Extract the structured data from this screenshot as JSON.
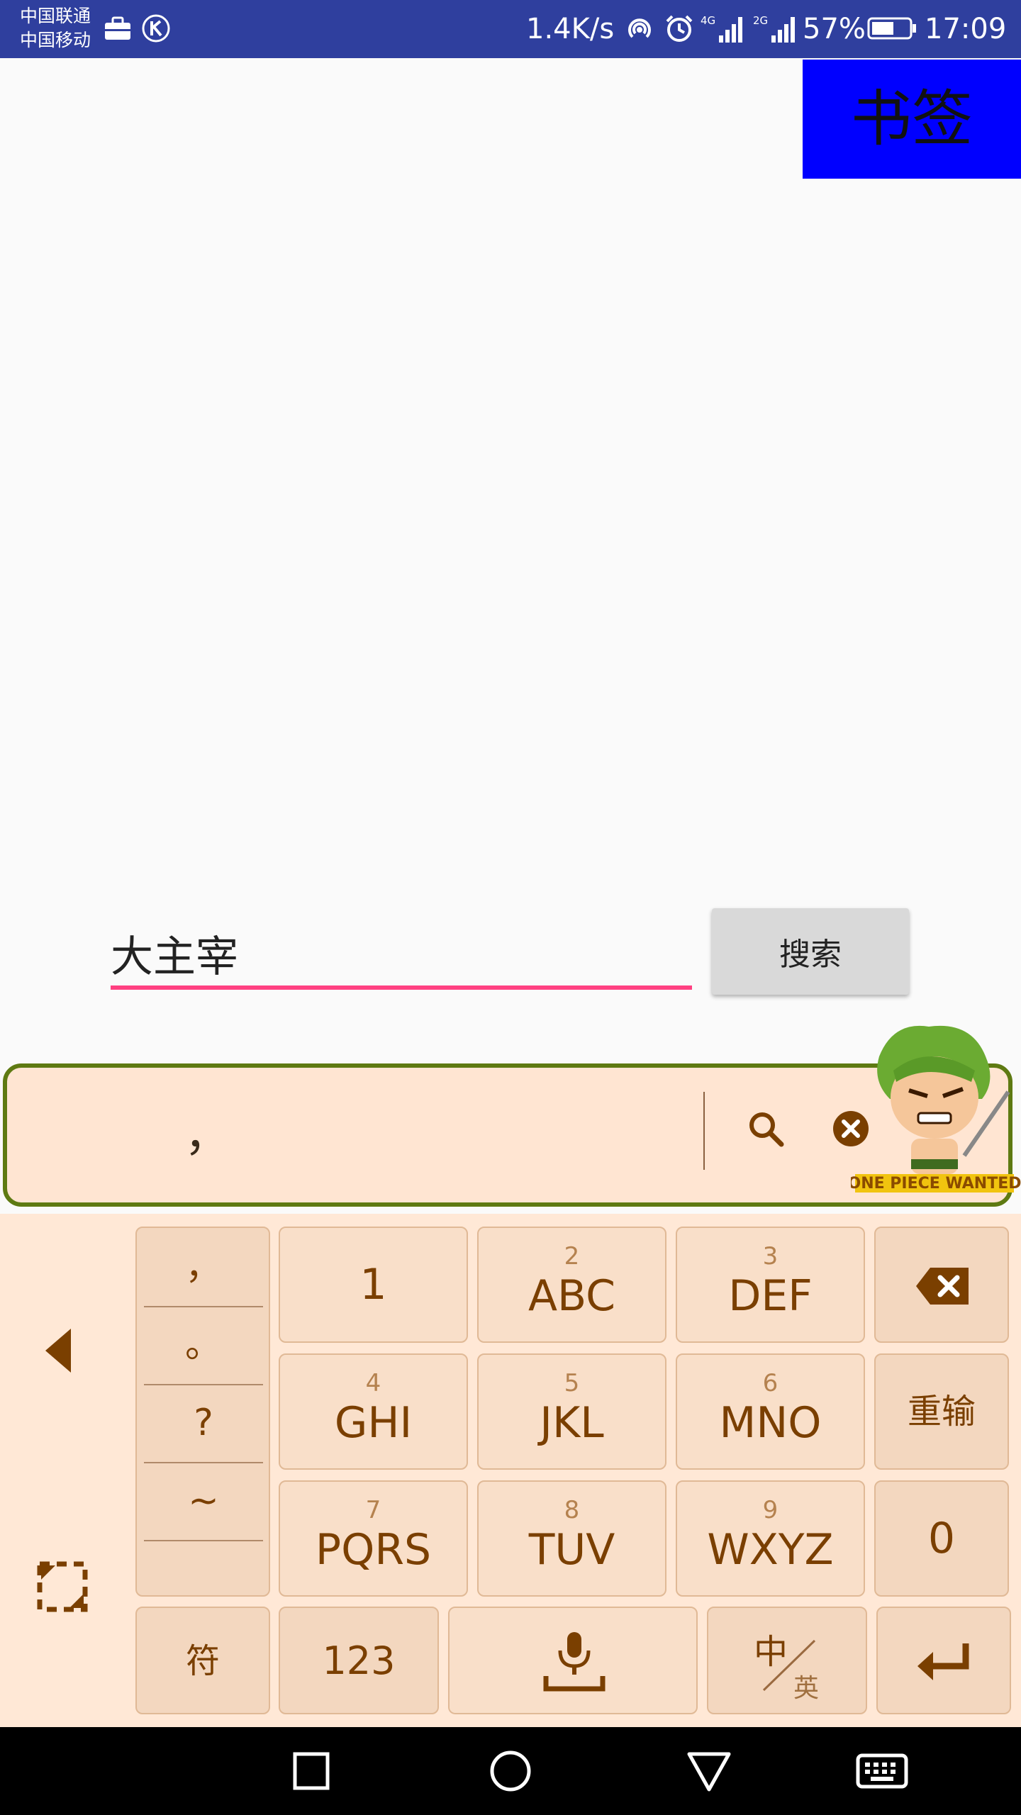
{
  "status_bar": {
    "carrier_1": "中国联通",
    "carrier_2": "中国移动",
    "network_speed": "1.4K/s",
    "signal_4g": "4G",
    "signal_2g": "2G",
    "battery_percent": "57%",
    "time": "17:09",
    "icons": [
      "briefcase-icon",
      "k-app-icon",
      "hotspot-icon",
      "alarm-icon",
      "signal-4g-icon",
      "signal-2g-icon",
      "battery-icon"
    ]
  },
  "app": {
    "bookmark_label": "书签",
    "search_input_value": "大主宰",
    "search_button_label": "搜索",
    "colors": {
      "bookmark_bg": "#0000ff",
      "underline": "#ff4081",
      "statusbar": "#2f3f9e"
    }
  },
  "candidate_bar": {
    "candidate_text": "，",
    "mascot_caption": "ONE PIECE WANTED"
  },
  "keyboard": {
    "punctuation": [
      "，",
      "。",
      "?",
      "~"
    ],
    "keys": {
      "k1": {
        "num": "",
        "label": "1"
      },
      "k2": {
        "num": "2",
        "label": "ABC"
      },
      "k3": {
        "num": "3",
        "label": "DEF"
      },
      "k4": {
        "num": "4",
        "label": "GHI"
      },
      "k5": {
        "num": "5",
        "label": "JKL"
      },
      "k6": {
        "num": "6",
        "label": "MNO"
      },
      "k7": {
        "num": "7",
        "label": "PQRS"
      },
      "k8": {
        "num": "8",
        "label": "TUV"
      },
      "k9": {
        "num": "9",
        "label": "WXYZ"
      },
      "zero": "0"
    },
    "reenter_label": "重输",
    "symbols_label": "符",
    "numbers_label": "123",
    "lang_cn": "中",
    "lang_en": "英"
  }
}
